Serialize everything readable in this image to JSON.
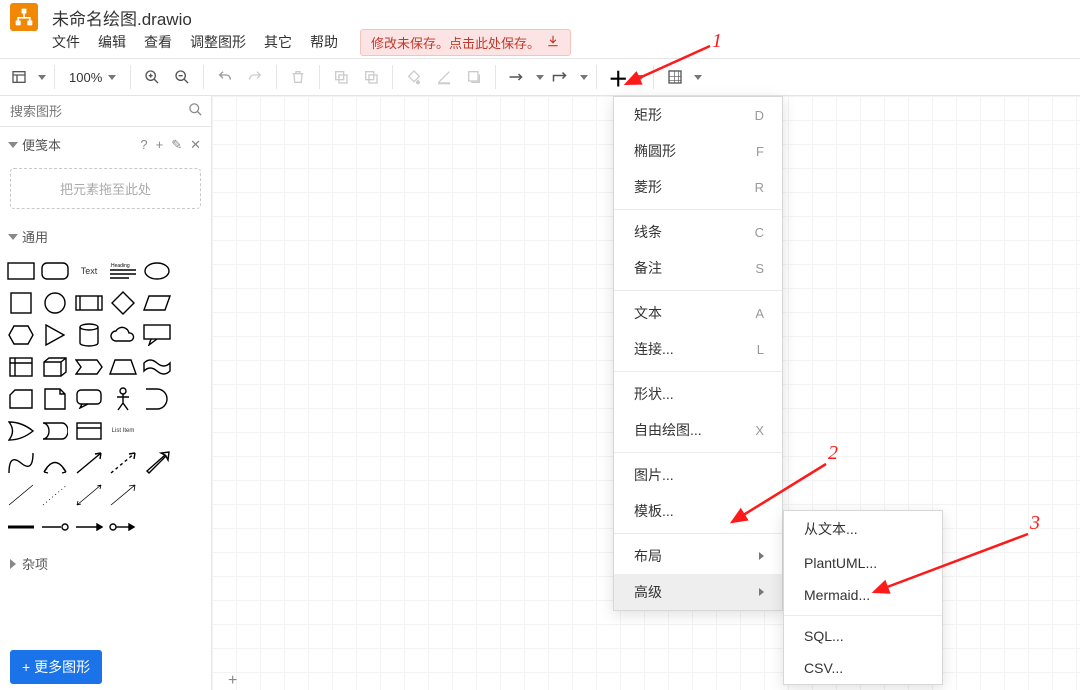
{
  "title": "未命名绘图.drawio",
  "menus": [
    "文件",
    "编辑",
    "查看",
    "调整图形",
    "其它",
    "帮助"
  ],
  "save_warning": "修改未保存。点击此处保存。",
  "zoom": "100%",
  "search_placeholder": "搜索图形",
  "scratchpad": {
    "title": "便笺本",
    "dropzone": "把元素拖至此处"
  },
  "general_title": "通用",
  "misc_title": "杂项",
  "more_shapes": "+ 更多图形",
  "shape_labels": {
    "text": "Text",
    "heading": "Heading",
    "list": "List Item"
  },
  "insert_menu": [
    {
      "label": "矩形",
      "shortcut": "D"
    },
    {
      "label": "椭圆形",
      "shortcut": "F"
    },
    {
      "label": "菱形",
      "shortcut": "R"
    },
    {
      "sep": true
    },
    {
      "label": "线条",
      "shortcut": "C"
    },
    {
      "label": "备注",
      "shortcut": "S"
    },
    {
      "sep": true
    },
    {
      "label": "文本",
      "shortcut": "A"
    },
    {
      "label": "连接...",
      "shortcut": "L"
    },
    {
      "sep": true
    },
    {
      "label": "形状..."
    },
    {
      "label": "自由绘图...",
      "shortcut": "X"
    },
    {
      "sep": true
    },
    {
      "label": "图片..."
    },
    {
      "label": "模板..."
    },
    {
      "sep": true
    },
    {
      "label": "布局",
      "submenu": true
    },
    {
      "label": "高级",
      "submenu": true,
      "highlight": true
    }
  ],
  "advanced_menu": [
    {
      "label": "从文本..."
    },
    {
      "label": "PlantUML..."
    },
    {
      "label": "Mermaid..."
    },
    {
      "sep": true
    },
    {
      "label": "SQL..."
    },
    {
      "label": "CSV..."
    }
  ],
  "annotations": {
    "a1": "1",
    "a2": "2",
    "a3": "3"
  }
}
